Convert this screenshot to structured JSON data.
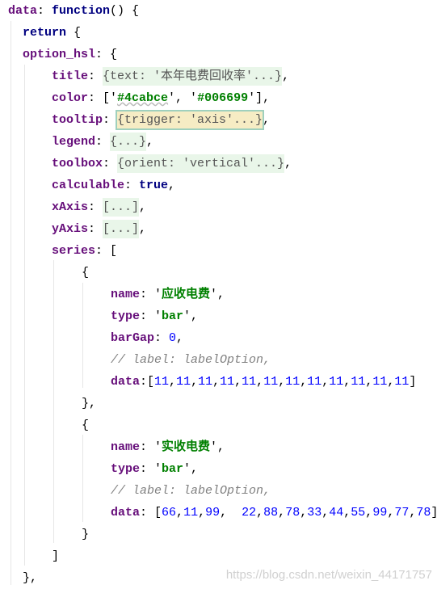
{
  "editor": {
    "lines": [
      {
        "depth": 0,
        "tokens": [
          [
            "k",
            "data"
          ],
          [
            "p",
            ": "
          ],
          [
            "kw",
            "function"
          ],
          [
            "p",
            "() {"
          ]
        ]
      },
      {
        "depth": 1,
        "tokens": [
          [
            "kw",
            "return"
          ],
          [
            "p",
            " {"
          ]
        ]
      },
      {
        "depth": 1,
        "tokens": [
          [
            "k",
            "option_hsl"
          ],
          [
            "p",
            ": {"
          ]
        ]
      },
      {
        "depth": 2,
        "tokens": [
          [
            "k",
            "title"
          ],
          [
            "p",
            ": "
          ],
          [
            "fold",
            "{text: '本年电费回收率'...}"
          ],
          [
            "p",
            ","
          ]
        ]
      },
      {
        "depth": 2,
        "tokens": [
          [
            "k",
            "color"
          ],
          [
            "p",
            ": ['"
          ],
          [
            "s wave",
            "#4cabce"
          ],
          [
            "p",
            "', '"
          ],
          [
            "s",
            "#006699"
          ],
          [
            "p",
            "'],"
          ]
        ]
      },
      {
        "depth": 2,
        "tokens": [
          [
            "k",
            "tooltip"
          ],
          [
            "p",
            ": "
          ],
          [
            "tip",
            "{trigger: 'axis'...}"
          ],
          [
            "p",
            ","
          ]
        ]
      },
      {
        "depth": 2,
        "tokens": [
          [
            "k",
            "legend"
          ],
          [
            "p",
            ": "
          ],
          [
            "fold",
            "{...}"
          ],
          [
            "p",
            ","
          ]
        ]
      },
      {
        "depth": 2,
        "tokens": [
          [
            "k",
            "toolbox"
          ],
          [
            "p",
            ": "
          ],
          [
            "fold",
            "{orient: 'vertical'...}"
          ],
          [
            "p",
            ","
          ]
        ]
      },
      {
        "depth": 2,
        "tokens": [
          [
            "k",
            "calculable"
          ],
          [
            "p",
            ": "
          ],
          [
            "kw",
            "true"
          ],
          [
            "p",
            ","
          ]
        ]
      },
      {
        "depth": 2,
        "tokens": [
          [
            "k",
            "xAxis"
          ],
          [
            "p",
            ": "
          ],
          [
            "fold",
            "[...]"
          ],
          [
            "p",
            ","
          ]
        ]
      },
      {
        "depth": 2,
        "tokens": [
          [
            "k",
            "yAxis"
          ],
          [
            "p",
            ": "
          ],
          [
            "fold",
            "[...]"
          ],
          [
            "p",
            ","
          ]
        ]
      },
      {
        "depth": 2,
        "tokens": [
          [
            "k",
            "series"
          ],
          [
            "p",
            ": ["
          ]
        ]
      },
      {
        "depth": 3,
        "tokens": [
          [
            "p",
            "{"
          ]
        ]
      },
      {
        "depth": 4,
        "tokens": [
          [
            "k",
            "name"
          ],
          [
            "p",
            ": '"
          ],
          [
            "s",
            "应收电费"
          ],
          [
            "p",
            "',"
          ]
        ]
      },
      {
        "depth": 4,
        "tokens": [
          [
            "k",
            "type"
          ],
          [
            "p",
            ": '"
          ],
          [
            "s",
            "bar"
          ],
          [
            "p",
            "',"
          ]
        ]
      },
      {
        "depth": 4,
        "tokens": [
          [
            "k",
            "barGap"
          ],
          [
            "p",
            ": "
          ],
          [
            "n",
            "0"
          ],
          [
            "p",
            ","
          ]
        ]
      },
      {
        "depth": 4,
        "tokens": [
          [
            "c",
            "// label: labelOption,"
          ]
        ]
      },
      {
        "depth": 4,
        "tokens": [
          [
            "k",
            "data"
          ],
          [
            "p",
            ":["
          ],
          [
            "n",
            "11"
          ],
          [
            "p",
            ","
          ],
          [
            "n",
            "11"
          ],
          [
            "p",
            ","
          ],
          [
            "n",
            "11"
          ],
          [
            "p",
            ","
          ],
          [
            "n",
            "11"
          ],
          [
            "p",
            ","
          ],
          [
            "n",
            "11"
          ],
          [
            "p",
            ","
          ],
          [
            "n",
            "11"
          ],
          [
            "p",
            ","
          ],
          [
            "n",
            "11"
          ],
          [
            "p",
            ","
          ],
          [
            "n",
            "11"
          ],
          [
            "p",
            ","
          ],
          [
            "n",
            "11"
          ],
          [
            "p",
            ","
          ],
          [
            "n",
            "11"
          ],
          [
            "p",
            ","
          ],
          [
            "n",
            "11"
          ],
          [
            "p",
            ","
          ],
          [
            "n",
            "11"
          ],
          [
            "p",
            "]"
          ]
        ]
      },
      {
        "depth": 3,
        "tokens": [
          [
            "p",
            "},"
          ]
        ]
      },
      {
        "depth": 3,
        "tokens": [
          [
            "p",
            "{"
          ]
        ]
      },
      {
        "depth": 4,
        "tokens": [
          [
            "k",
            "name"
          ],
          [
            "p",
            ": '"
          ],
          [
            "s",
            "实收电费"
          ],
          [
            "p",
            "',"
          ]
        ]
      },
      {
        "depth": 4,
        "tokens": [
          [
            "k",
            "type"
          ],
          [
            "p",
            ": '"
          ],
          [
            "s",
            "bar"
          ],
          [
            "p",
            "',"
          ]
        ]
      },
      {
        "depth": 4,
        "tokens": [
          [
            "c",
            "// label: labelOption,"
          ]
        ]
      },
      {
        "depth": 4,
        "tokens": [
          [
            "k",
            "data"
          ],
          [
            "p",
            ": ["
          ],
          [
            "n",
            "66"
          ],
          [
            "p",
            ","
          ],
          [
            "n",
            "11"
          ],
          [
            "p",
            ","
          ],
          [
            "n",
            "99"
          ],
          [
            "p",
            ",  "
          ],
          [
            "n",
            "22"
          ],
          [
            "p",
            ","
          ],
          [
            "n",
            "88"
          ],
          [
            "p",
            ","
          ],
          [
            "n",
            "78"
          ],
          [
            "p",
            ","
          ],
          [
            "n",
            "33"
          ],
          [
            "p",
            ","
          ],
          [
            "n",
            "44"
          ],
          [
            "p",
            ","
          ],
          [
            "n",
            "55"
          ],
          [
            "p",
            ","
          ],
          [
            "n",
            "99"
          ],
          [
            "p",
            ","
          ],
          [
            "n",
            "77"
          ],
          [
            "p",
            ","
          ],
          [
            "n",
            "78"
          ],
          [
            "p",
            "]"
          ]
        ]
      },
      {
        "depth": 3,
        "tokens": [
          [
            "p",
            "}"
          ]
        ]
      },
      {
        "depth": 2,
        "tokens": [
          [
            "p",
            "]"
          ]
        ]
      },
      {
        "depth": 1,
        "tokens": [
          [
            "p",
            "},"
          ]
        ]
      }
    ]
  },
  "watermark": "https://blog.csdn.net/weixin_44171757"
}
